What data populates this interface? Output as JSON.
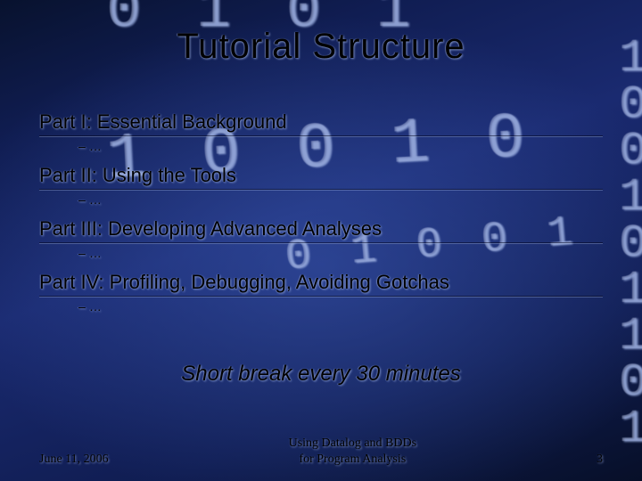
{
  "title": "Tutorial Structure",
  "parts": [
    {
      "heading": "Part I: Essential Background",
      "sub": "…"
    },
    {
      "heading": "Part II: Using the Tools",
      "sub": "…"
    },
    {
      "heading": "Part III: Developing Advanced Analyses",
      "sub": "…"
    },
    {
      "heading": "Part IV: Profiling, Debugging, Avoiding Gotchas",
      "sub": "…"
    }
  ],
  "note": "Short break every 30 minutes",
  "footer": {
    "date": "June 11, 2006",
    "center_line1": "Using Datalog and BDDs",
    "center_line2": "for Program Analysis",
    "page": "3"
  }
}
